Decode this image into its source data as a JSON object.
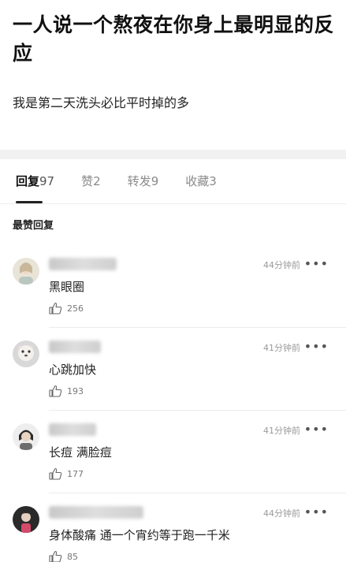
{
  "post": {
    "title": "一人说一个熬夜在你身上最明显的反应",
    "body": "我是第二天洗头必比平时掉的多"
  },
  "tabs": [
    {
      "label": "回复",
      "count": "97",
      "active": true
    },
    {
      "label": "赞",
      "count": "2",
      "active": false
    },
    {
      "label": "转发",
      "count": "9",
      "active": false
    },
    {
      "label": "收藏",
      "count": "3",
      "active": false
    }
  ],
  "section_title": "最赞回复",
  "comments": [
    {
      "time": "44分钟前",
      "text": "黑眼圈",
      "likes": "256",
      "more": "•••"
    },
    {
      "time": "41分钟前",
      "text": "心跳加快",
      "likes": "193",
      "more": "•••"
    },
    {
      "time": "41分钟前",
      "text": "长痘 满脸痘",
      "likes": "177",
      "more": "•••"
    },
    {
      "time": "44分钟前",
      "text": "身体酸痛 通一个宵约等于跑一千米",
      "likes": "85",
      "more": "•••"
    }
  ],
  "icons": {
    "like": "thumbs-up-icon",
    "more": "more-dots-icon",
    "avatar": "avatar"
  }
}
